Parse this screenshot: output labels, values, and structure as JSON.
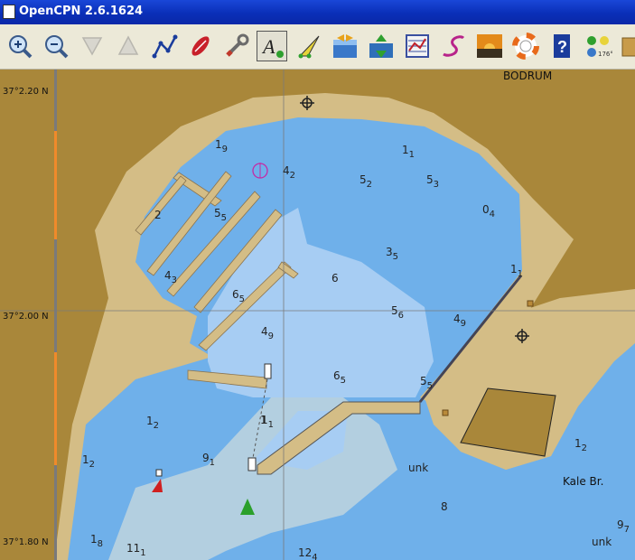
{
  "window": {
    "title": "OpenCPN 2.6.1624"
  },
  "toolbar": {
    "buttons": [
      {
        "name": "zoom-in",
        "icon": "zoom-in-icon"
      },
      {
        "name": "zoom-out",
        "icon": "zoom-out-icon"
      },
      {
        "name": "scale-in",
        "icon": "scale-in-icon"
      },
      {
        "name": "scale-out",
        "icon": "scale-out-icon"
      },
      {
        "name": "route",
        "icon": "route-icon"
      },
      {
        "name": "ship-follow",
        "icon": "ship-icon"
      },
      {
        "name": "settings",
        "icon": "wrench-icon"
      },
      {
        "name": "text",
        "icon": "text-icon"
      },
      {
        "name": "current",
        "icon": "current-icon"
      },
      {
        "name": "tide",
        "icon": "tide-icon"
      },
      {
        "name": "tide-height",
        "icon": "tide-height-icon"
      },
      {
        "name": "route-manager",
        "icon": "route-manager-icon"
      },
      {
        "name": "track",
        "icon": "track-icon"
      },
      {
        "name": "color-scheme",
        "icon": "sunset-icon"
      },
      {
        "name": "mob",
        "icon": "lifebuoy-icon"
      },
      {
        "name": "help",
        "icon": "help-icon"
      },
      {
        "name": "gps-status",
        "icon": "gps-status-icon"
      },
      {
        "name": "more",
        "icon": "more-icon"
      }
    ]
  },
  "chart": {
    "place_name": "BODRUM",
    "landmark": "Kale Br.",
    "latitudes": [
      "37°2.20 N",
      "37°2.00 N",
      "37°1.80 N"
    ],
    "soundings": [
      {
        "main": "1",
        "sub": "9"
      },
      {
        "main": "1",
        "sub": "1"
      },
      {
        "main": "4",
        "sub": "2"
      },
      {
        "main": "5",
        "sub": "2"
      },
      {
        "main": "5",
        "sub": "3"
      },
      {
        "main": "2",
        "sub": ""
      },
      {
        "main": "5",
        "sub": "5"
      },
      {
        "main": "0",
        "sub": "4"
      },
      {
        "main": "3",
        "sub": "5"
      },
      {
        "main": "4",
        "sub": "3"
      },
      {
        "main": "1",
        "sub": "1"
      },
      {
        "main": "6",
        "sub": ""
      },
      {
        "main": "6",
        "sub": "5"
      },
      {
        "main": "5",
        "sub": "6"
      },
      {
        "main": "4",
        "sub": "9"
      },
      {
        "main": "4",
        "sub": "9"
      },
      {
        "main": "6",
        "sub": "5"
      },
      {
        "main": "5",
        "sub": "5"
      },
      {
        "main": "1",
        "sub": ""
      },
      {
        "main": "1",
        "sub": "2"
      },
      {
        "main": "1",
        "sub": "1"
      },
      {
        "main": "1",
        "sub": "2"
      },
      {
        "main": "9",
        "sub": "1"
      },
      {
        "main": "1",
        "sub": "2"
      },
      {
        "main": "unk",
        "sub": ""
      },
      {
        "main": "8",
        "sub": ""
      },
      {
        "main": "9",
        "sub": "7"
      },
      {
        "main": "1",
        "sub": "8"
      },
      {
        "main": "unk",
        "sub": ""
      },
      {
        "main": "11",
        "sub": "1"
      },
      {
        "main": "12",
        "sub": "4"
      }
    ]
  }
}
